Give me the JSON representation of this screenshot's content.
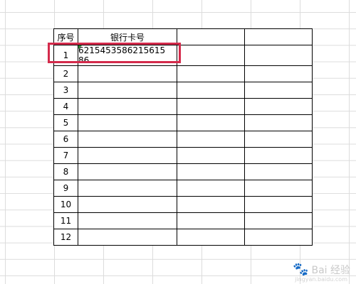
{
  "sheet": {
    "headers": [
      "序号",
      "银行卡号",
      "",
      ""
    ],
    "rows": [
      {
        "num": "1",
        "card": "6215453586215615 86"
      },
      {
        "num": "2",
        "card": ""
      },
      {
        "num": "3",
        "card": ""
      },
      {
        "num": "4",
        "card": ""
      },
      {
        "num": "5",
        "card": ""
      },
      {
        "num": "6",
        "card": ""
      },
      {
        "num": "7",
        "card": ""
      },
      {
        "num": "8",
        "card": ""
      },
      {
        "num": "9",
        "card": ""
      },
      {
        "num": "10",
        "card": ""
      },
      {
        "num": "11",
        "card": ""
      },
      {
        "num": "12",
        "card": ""
      }
    ]
  },
  "highlight_color": "#d42a4b",
  "watermark": {
    "text": "Bai 经验",
    "sub": "jingyan.baidu.com"
  }
}
